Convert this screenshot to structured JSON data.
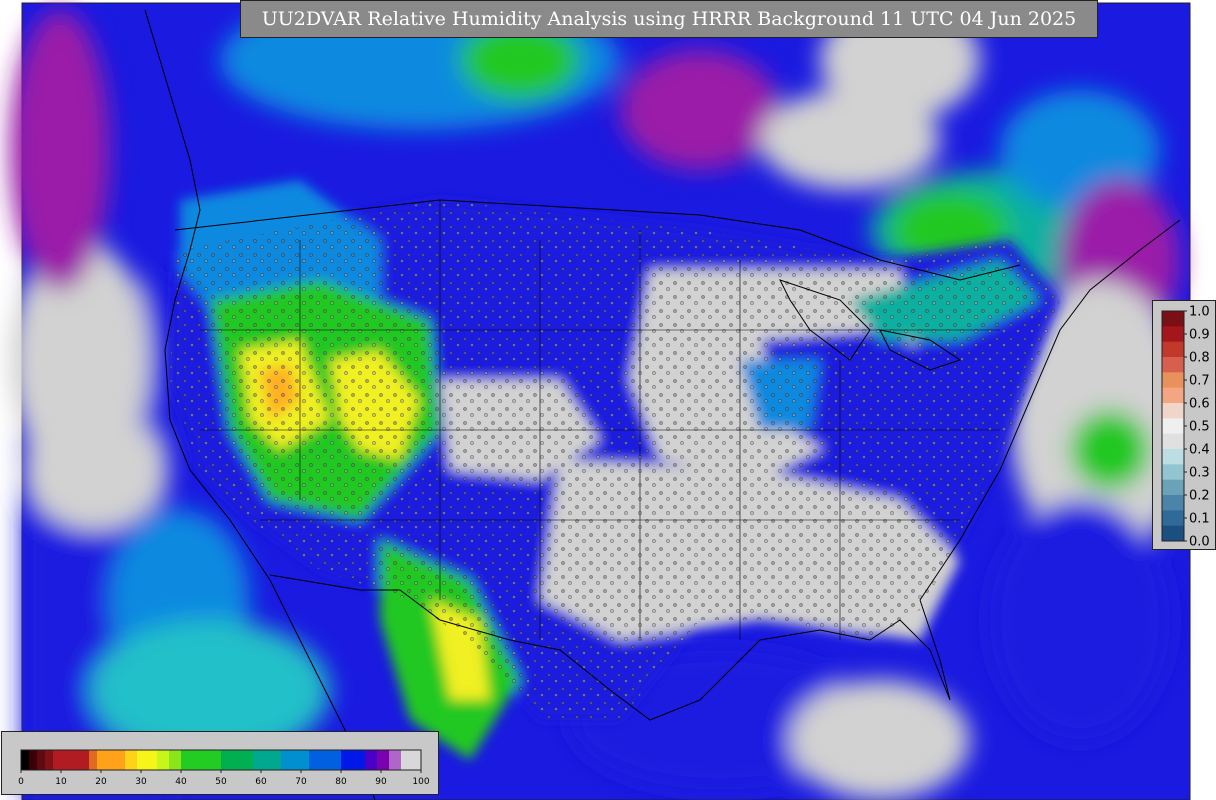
{
  "title": "UU2DVAR Relative Humidity Analysis using HRRR Background 11 UTC 04 Jun 2025",
  "observation_legend": {
    "ticks": [
      "1.0",
      "0.9",
      "0.8",
      "0.7",
      "0.6",
      "0.5",
      "0.4",
      "0.3",
      "0.2",
      "0.1",
      "0.0"
    ],
    "colors": [
      "#7a0f16",
      "#a3171c",
      "#c0392b",
      "#d6604d",
      "#e8915c",
      "#f4a582",
      "#f0d6c8",
      "#efefef",
      "#e0e0e0",
      "#bcdde4",
      "#92c5d0",
      "#6aa2b8",
      "#4b84a8",
      "#2f6a98",
      "#1b4f82"
    ]
  },
  "rh_colorbar": {
    "tick_labels": [
      "0",
      "10",
      "20",
      "30",
      "40",
      "50",
      "60",
      "70",
      "80",
      "90",
      "100"
    ],
    "colors": [
      {
        "from": 0,
        "to": 2,
        "color": "#000000"
      },
      {
        "from": 2,
        "to": 4,
        "color": "#3a0006"
      },
      {
        "from": 4,
        "to": 6,
        "color": "#5e0a10"
      },
      {
        "from": 6,
        "to": 8,
        "color": "#7f1117"
      },
      {
        "from": 8,
        "to": 17,
        "color": "#b01c22"
      },
      {
        "from": 17,
        "to": 19,
        "color": "#e06a20"
      },
      {
        "from": 19,
        "to": 26,
        "color": "#ffa21a"
      },
      {
        "from": 26,
        "to": 29,
        "color": "#ffd21a"
      },
      {
        "from": 29,
        "to": 34,
        "color": "#f5f51a"
      },
      {
        "from": 34,
        "to": 37,
        "color": "#c8f51a"
      },
      {
        "from": 37,
        "to": 40,
        "color": "#8ae61a"
      },
      {
        "from": 40,
        "to": 50,
        "color": "#22cc22"
      },
      {
        "from": 50,
        "to": 58,
        "color": "#00b050"
      },
      {
        "from": 58,
        "to": 65,
        "color": "#00a890"
      },
      {
        "from": 65,
        "to": 72,
        "color": "#0090d0"
      },
      {
        "from": 72,
        "to": 80,
        "color": "#0060e0"
      },
      {
        "from": 80,
        "to": 86,
        "color": "#0018e8"
      },
      {
        "from": 86,
        "to": 89,
        "color": "#4a00c8"
      },
      {
        "from": 89,
        "to": 92,
        "color": "#7a00b0"
      },
      {
        "from": 92,
        "to": 95,
        "color": "#b066c8"
      },
      {
        "from": 95,
        "to": 100,
        "color": "#d8d8d8"
      }
    ]
  },
  "field_colors": {
    "very_moist": "#d2d2d2",
    "purple": "#9a1aa8",
    "blue": "#1a1ae0",
    "sky": "#0a8ae0",
    "teal": "#10b0a0",
    "green": "#22c822",
    "lime": "#8ae61a",
    "yellow": "#f0f020",
    "orange": "#ffb020",
    "coast": "#000000"
  }
}
